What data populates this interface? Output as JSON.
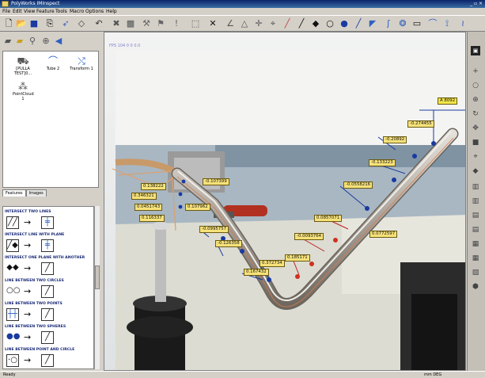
{
  "window": {
    "title": "PolyWorks IMInspect",
    "controls": "_ ▫ ×"
  },
  "menu": [
    "File",
    "Edit",
    "View",
    "Feature",
    "Tools",
    "Macro",
    "Options",
    "Help"
  ],
  "features_panel": {
    "items": [
      {
        "label": "[PULLA TEST]0..."
      },
      {
        "label": "Tube 2"
      },
      {
        "label": "Transform 1"
      },
      {
        "label": "PointCloud 1"
      }
    ],
    "tabs": [
      "Features",
      "Images"
    ]
  },
  "viewport": {
    "coord_readout": "FPS 104 0 0 0.0"
  },
  "commands": [
    {
      "title": "INTERSECT TWO LINES",
      "icons": [
        "╱╱",
        "╪"
      ]
    },
    {
      "title": "INTERSECT LINE WITH PLANE",
      "icons": [
        "╱◆",
        "╪"
      ]
    },
    {
      "title": "INTERSECT ONE PLANE WITH ANOTHER",
      "icons": [
        "◆◆",
        "╱"
      ]
    },
    {
      "title": "LINE BETWEEN TWO CIRCLES",
      "icons": [
        "○○",
        "╱"
      ]
    },
    {
      "title": "LINE BETWEEN TWO POINTS",
      "icons": [
        "┼┼",
        "╱"
      ]
    },
    {
      "title": "LINE BETWEEN TWO SPHERES",
      "icons": [
        "●●",
        "╱"
      ]
    },
    {
      "title": "LINE BETWEEN POINT AND CIRCLE",
      "icons": [
        "·○",
        "╱"
      ]
    }
  ],
  "labels": {
    "l1": "A 8092",
    "l2": "-0.274455",
    "l3": "-0.20892",
    "l4": "-0.133223",
    "l5": "-0.0558216",
    "l6": "0.0857071",
    "l7": "0.0772597",
    "l8": "-0.0093764",
    "l9": "0.185171",
    "l10": "0.372734",
    "l11": "0.167432",
    "l12": "-0.126358",
    "l13": "-0.0995757",
    "l14": "0.107962",
    "l15": "-0.107399",
    "l16": "0.138222",
    "l17": "0.346321",
    "l18": "0.0451743",
    "l19": "0.116337"
  },
  "status": {
    "left": "Ready",
    "right": "mm   DEG"
  },
  "colors": {
    "label_fill": "#f7e27a",
    "title_bar": "#0a246a",
    "tube": "#b9b4ad"
  }
}
